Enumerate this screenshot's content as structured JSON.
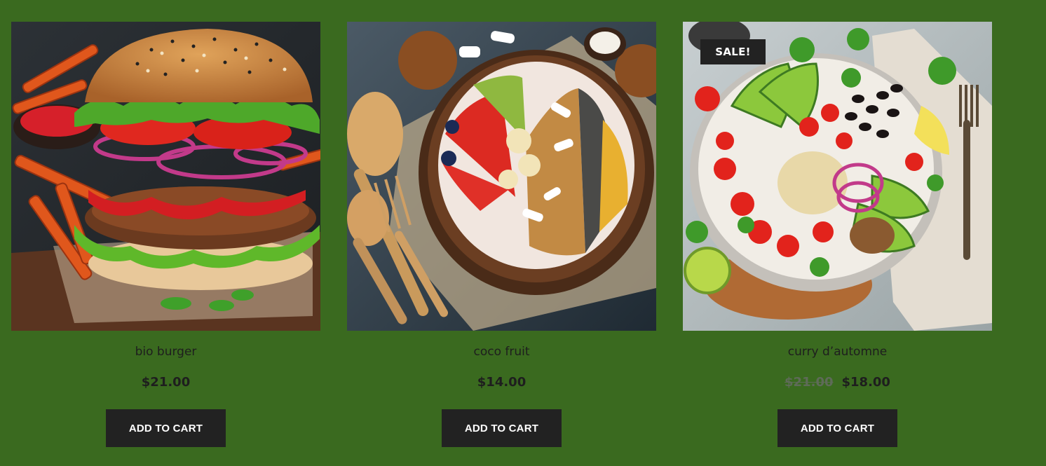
{
  "colors": {
    "page_background": "#3a6a1f",
    "button_background": "#222222",
    "button_text": "#ffffff",
    "text": "#1e1e1e"
  },
  "products": [
    {
      "name": "bio burger",
      "price": "$21.00",
      "old_price": null,
      "sale_badge": null,
      "button_label": "ADD TO CART",
      "image": "burger-photo"
    },
    {
      "name": "coco fruit",
      "price": "$14.00",
      "old_price": null,
      "sale_badge": null,
      "button_label": "ADD TO CART",
      "image": "coconut-bowl-photo"
    },
    {
      "name": "curry d’automne",
      "price": "$18.00",
      "old_price": "$21.00",
      "sale_badge": "SALE!",
      "button_label": "ADD TO CART",
      "image": "salad-bowl-photo"
    }
  ]
}
